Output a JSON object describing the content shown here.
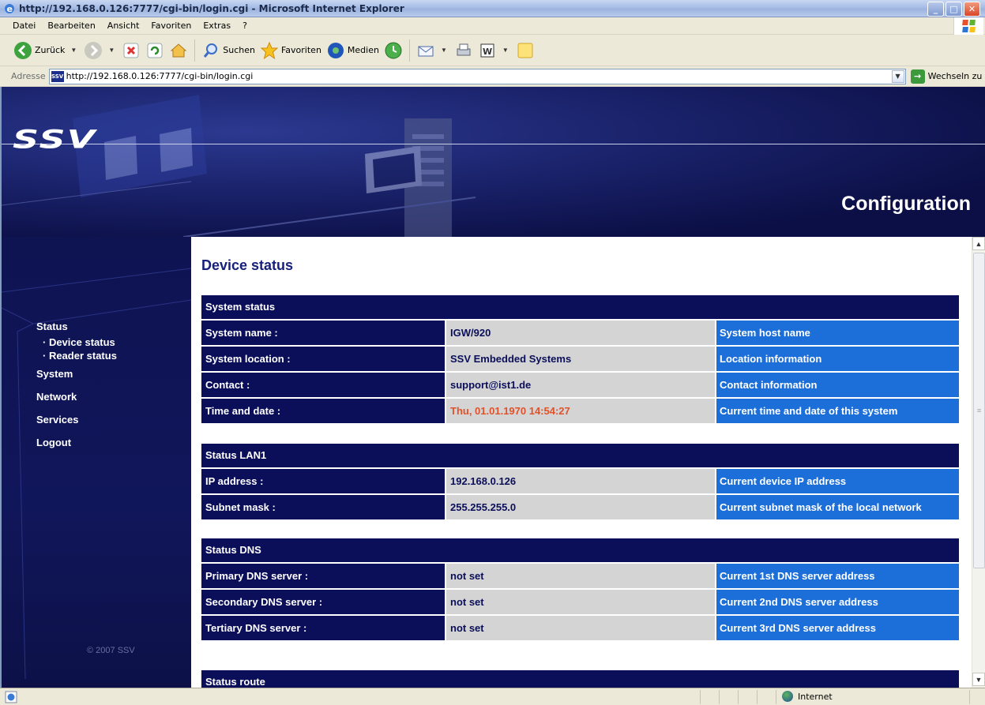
{
  "window": {
    "title": "http://192.168.0.126:7777/cgi-bin/login.cgi - Microsoft Internet Explorer",
    "buttons": {
      "minimize": "_",
      "maximize": "□",
      "close": "✕"
    }
  },
  "menu": [
    "Datei",
    "Bearbeiten",
    "Ansicht",
    "Favoriten",
    "Extras",
    "?"
  ],
  "toolbar": {
    "back_label": "Zurück",
    "search_label": "Suchen",
    "favorites_label": "Favoriten",
    "media_label": "Medien"
  },
  "address": {
    "label": "Adresse",
    "url": "http://192.168.0.126:7777/cgi-bin/login.cgi",
    "site_icon_text": "SSV",
    "go_label": "Wechseln zu"
  },
  "banner": {
    "logo": "SSV",
    "title": "Configuration"
  },
  "sidebar": {
    "status": "Status",
    "status_items": [
      "· Device status",
      "· Reader status"
    ],
    "items": [
      "System",
      "Network",
      "Services",
      "Logout"
    ],
    "copyright": "© 2007 SSV"
  },
  "page": {
    "title": "Device status",
    "sections": [
      {
        "title": "System status",
        "rows": [
          {
            "label": "System name :",
            "value": "IGW/920",
            "desc": "System host name"
          },
          {
            "label": "System location :",
            "value": "SSV Embedded Systems",
            "desc": "Location information"
          },
          {
            "label": "Contact :",
            "value": "support@ist1.de",
            "desc": "Contact information"
          },
          {
            "label": "Time and date :",
            "value": "Thu, 01.01.1970 14:54:27",
            "desc": "Current time and date of this system"
          }
        ]
      },
      {
        "title": "Status LAN1",
        "rows": [
          {
            "label": "IP address :",
            "value": "192.168.0.126",
            "desc": "Current device IP address"
          },
          {
            "label": "Subnet mask :",
            "value": "255.255.255.0",
            "desc": "Current subnet mask of the local network"
          }
        ]
      },
      {
        "title": "Status DNS",
        "rows": [
          {
            "label": "Primary DNS server :",
            "value": "not set",
            "desc": "Current 1st DNS server address"
          },
          {
            "label": "Secondary DNS server :",
            "value": "not set",
            "desc": "Current 2nd DNS server address"
          },
          {
            "label": "Tertiary DNS server :",
            "value": "not set",
            "desc": "Current 3rd DNS server address"
          }
        ]
      },
      {
        "title": "Status route",
        "rows": []
      }
    ]
  },
  "statusbar": {
    "zone": "Internet"
  },
  "colors": {
    "navy": "#0b0f5a",
    "value_bg": "#d4d4d4",
    "desc_bg": "#1c6fd8",
    "alert": "#e0522a"
  }
}
